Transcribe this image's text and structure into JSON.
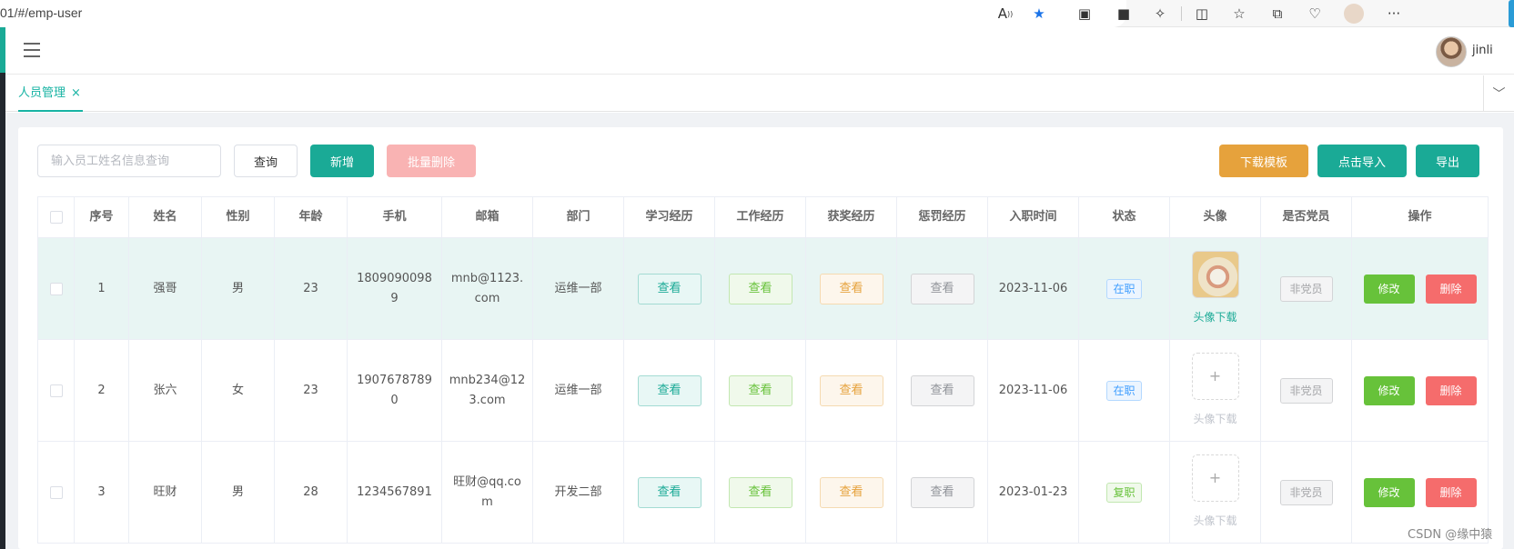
{
  "browser": {
    "url": "01/#/emp-user",
    "icons": [
      "read-aloud-icon",
      "favorite-star-icon",
      "extension-icon",
      "extension-icon",
      "puzzle-icon",
      "split-screen-icon",
      "favorites-icon",
      "collections-icon",
      "performance-icon",
      "profile-avatar-icon",
      "more-icon"
    ]
  },
  "header": {
    "username": "jinli"
  },
  "tags": {
    "active": "人员管理",
    "close": "×"
  },
  "toolbar": {
    "search_placeholder": "输入员工姓名信息查询",
    "query": "查询",
    "add": "新增",
    "batch_delete": "批量删除",
    "download_template": "下载模板",
    "import": "点击导入",
    "export": "导出"
  },
  "table": {
    "columns": [
      "序号",
      "姓名",
      "性别",
      "年龄",
      "手机",
      "邮箱",
      "部门",
      "学习经历",
      "工作经历",
      "获奖经历",
      "惩罚经历",
      "入职时间",
      "状态",
      "头像",
      "是否党员",
      "操作"
    ],
    "rows": [
      {
        "no": "1",
        "name": "强哥",
        "gender": "男",
        "age": "23",
        "phone": "18090900989",
        "email": "mnb@1123.com",
        "dept": "运维一部",
        "view": "查看",
        "date": "2023-11-06",
        "status": "在职",
        "avatar_link": "头像下载",
        "party": "非党员",
        "edit": "修改",
        "delete": "删除"
      },
      {
        "no": "2",
        "name": "张六",
        "gender": "女",
        "age": "23",
        "phone": "19076787890",
        "email": "mnb234@123.com",
        "dept": "运维一部",
        "view": "查看",
        "date": "2023-11-06",
        "status": "在职",
        "avatar_link": "头像下载",
        "party": "非党员",
        "edit": "修改",
        "delete": "删除"
      },
      {
        "no": "3",
        "name": "旺财",
        "gender": "男",
        "age": "28",
        "phone": "1234567891",
        "email": "旺财@qq.com",
        "dept": "开发二部",
        "view": "查看",
        "date": "2023-01-23",
        "status": "复职",
        "avatar_link": "头像下载",
        "party": "非党员",
        "edit": "修改",
        "delete": "删除"
      }
    ]
  },
  "upload_plus": "+",
  "watermark": "CSDN @缘中猿",
  "colors": {
    "primary": "#1aaa96",
    "warning": "#e6a23c",
    "danger": "#f56c6c",
    "success": "#67c23a"
  }
}
